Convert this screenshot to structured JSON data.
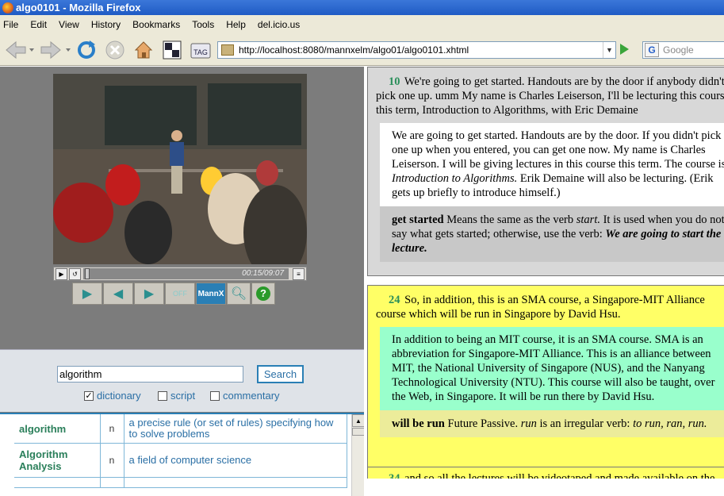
{
  "window": {
    "title": "algo0101 - Mozilla Firefox"
  },
  "menu": [
    "File",
    "Edit",
    "View",
    "History",
    "Bookmarks",
    "Tools",
    "Help",
    "del.icio.us"
  ],
  "toolbar": {
    "url": "http://localhost:8080/mannxelm/algo01/algo0101.xhtml",
    "search_placeholder": "Google",
    "tag_label": "TAG"
  },
  "player": {
    "time": "00:15/09:07",
    "buttons": [
      "play",
      "back",
      "forward",
      "OFF",
      "MannX",
      "zoom",
      "help"
    ],
    "off_label": "OFF",
    "mannx_label": "MannX",
    "help_label": "?"
  },
  "search": {
    "value": "algorithm",
    "button": "Search",
    "options": [
      {
        "label": "dictionary",
        "checked": true
      },
      {
        "label": "script",
        "checked": false
      },
      {
        "label": "commentary",
        "checked": false
      }
    ]
  },
  "dictionary": {
    "rows": [
      {
        "word": "algorithm",
        "pos": "n",
        "def": "a precise rule (or set of rules) specifying how to solve problems"
      },
      {
        "word": "Algorithm Analysis",
        "pos": "n",
        "def": "a field of computer science"
      }
    ]
  },
  "transcript": [
    {
      "num": "10",
      "original": "We're going to get started. Handouts are by the door if anybody didn't pick one up. umm My name is Charles Leiserson, I'll be lecturing this course this term, Introduction to Algorithms, with Eric Demaine",
      "explanation_a": "We are going to get started. Handouts are by the door. If you didn't pick one up when you entered, you can get one now. My name is Charles Leiserson. I will be giving lectures in this course this term. The course is ",
      "explanation_i": "Introduction to Algorithms.",
      "explanation_b": " Erik Demaine will also be lecturing. (Erik gets up briefly to introduce himself.)",
      "note_term": "get started",
      "note_a": " Means the same as the verb ",
      "note_i": "start.",
      "note_b": " It is used when you do not say what gets started; otherwise, use the verb: ",
      "note_bi": "We are going to start the lecture."
    },
    {
      "num": "24",
      "original": "So, in addition, this is an SMA course, a Singapore-MIT Alliance course which will be run in Singapore by David Hsu.",
      "explanation": "In addition to being an MIT course, it is an SMA course. SMA is an abbreviation for Singapore-MIT Alliance. This is an alliance between MIT, the National University of Singapore (NUS), and the Nanyang Technological University (NTU). This course will also be taught, over the Web, in Singapore. It will be run there by David Hsu.",
      "note_term": "will be run",
      "note_a": " Future Passive. ",
      "note_i1": "run",
      "note_b": " is an irregular verb: ",
      "note_i2": "to run, ran, run."
    },
    {
      "num": "34",
      "original": "and so all the lectures will be videotaped and made available on the Web"
    }
  ]
}
